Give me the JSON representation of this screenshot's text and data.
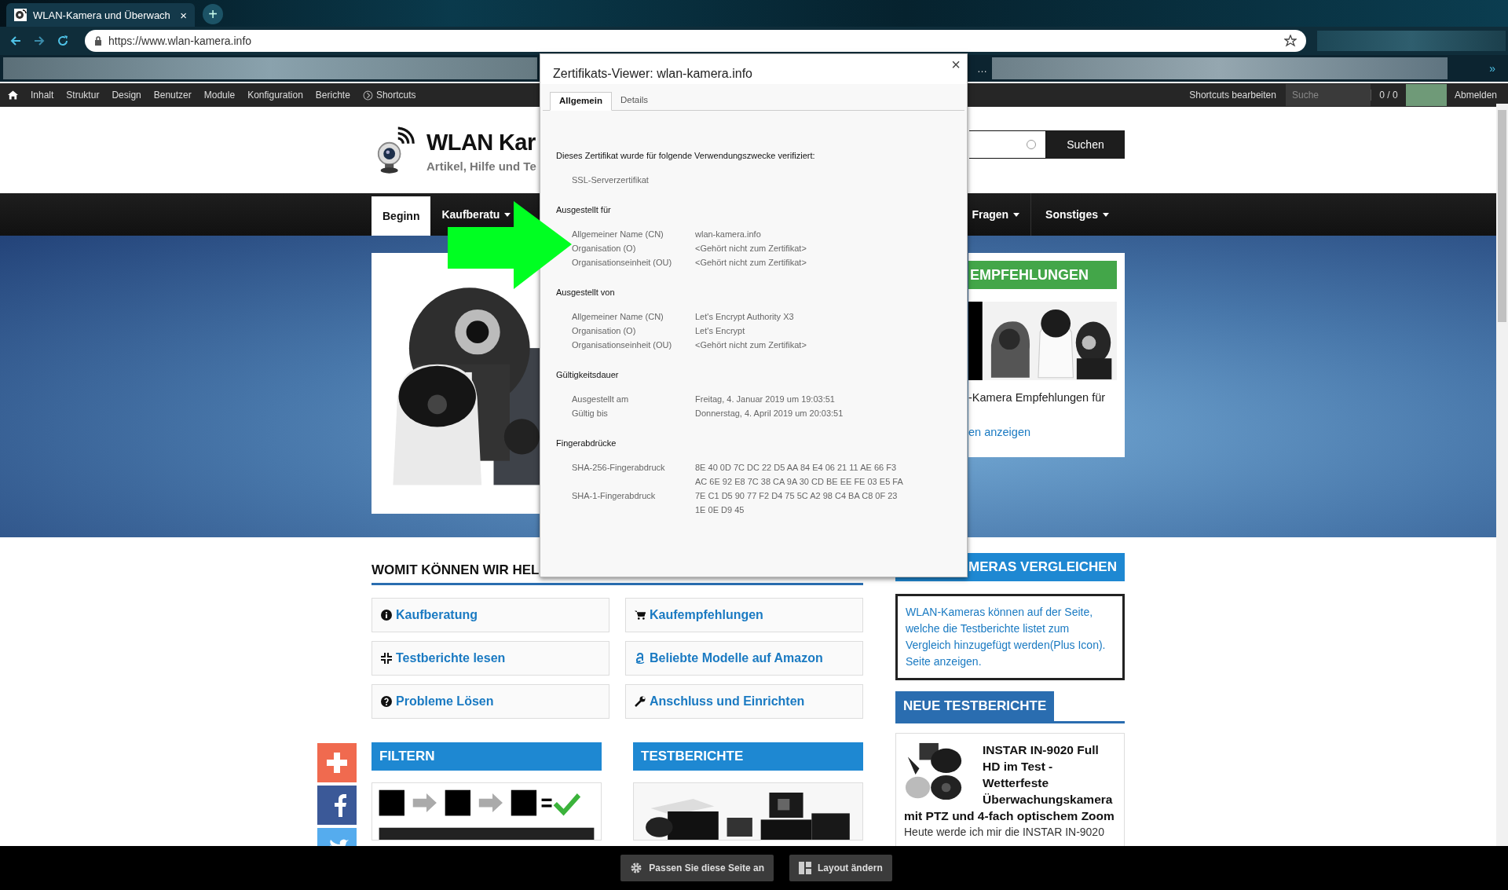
{
  "browser": {
    "tab": {
      "title": "WLAN-Kamera und Überwach",
      "close": "×",
      "selected": true
    },
    "new_tab": "+",
    "url": "https://www.wlan-kamera.info",
    "bookmark_ellipsis": "…",
    "bookmarks_overflow": "»"
  },
  "admin_toolbar": {
    "items": [
      {
        "label": "Inhalt",
        "kind": "text"
      },
      {
        "label": "Struktur",
        "kind": "text"
      },
      {
        "label": "Design",
        "kind": "text"
      },
      {
        "label": "Benutzer",
        "kind": "text"
      },
      {
        "label": "Module",
        "kind": "text"
      },
      {
        "label": "Konfiguration",
        "kind": "text"
      },
      {
        "label": "Berichte",
        "kind": "text"
      },
      {
        "label": "Shortcuts",
        "kind": "shortcuts"
      }
    ],
    "edit_shortcuts": "Shortcuts bearbeiten",
    "search_placeholder": "Suche",
    "counter": "0 / 0",
    "logout": "Abmelden"
  },
  "site_header": {
    "title": "WLAN Kar",
    "tagline": "Artikel, Hilfe und Te",
    "search_button": "Suchen"
  },
  "nav": [
    {
      "label": "Beginn",
      "selected": true,
      "dropdown": false
    },
    {
      "label": "Kaufberatu",
      "selected": false,
      "dropdown": true
    },
    {
      "label": "Fragen",
      "selected": false,
      "dropdown": true
    },
    {
      "label": "Sonstiges",
      "selected": false,
      "dropdown": true
    }
  ],
  "hero": {
    "recommendations": {
      "heading": "EMPFEHLUNGEN",
      "text": "-Kamera Empfehlungen für",
      "link": "en anzeigen"
    }
  },
  "help": {
    "heading": "WOMIT KÖNNEN WIR HEL",
    "links": [
      {
        "label": "Kaufberatung",
        "kind": "info"
      },
      {
        "label": "Kaufempfehlungen",
        "kind": "cart"
      },
      {
        "label": "Testberichte lesen",
        "kind": "compress"
      },
      {
        "label": "Beliebte Modelle auf Amazon",
        "kind": "amazon"
      },
      {
        "label": "Probleme Lösen",
        "kind": "question"
      },
      {
        "label": "Anschluss und Einrichten",
        "kind": "wrench"
      }
    ]
  },
  "blocks": [
    {
      "heading": "FILTERN",
      "kind": "filter"
    },
    {
      "heading": "TESTBERICHTE",
      "kind": "boxes"
    }
  ],
  "social": [
    {
      "kind": "plus"
    },
    {
      "kind": "facebook"
    },
    {
      "kind": "twitter"
    }
  ],
  "sidebar": {
    "compare": {
      "heading": "MERAS VERGLEICHEN",
      "text": "WLAN-Kameras können auf der Seite, welche die Testberichte listet zum Vergleich hinzugefügt werden(Plus Icon). Seite anzeigen."
    },
    "new_reviews": {
      "heading": "NEUE TESTBERICHTE",
      "title": "INSTAR IN-9020 Full HD im Test - Wetterfeste Überwachungskamera mit PTZ und 4-fach optischem Zoom",
      "excerpt": "Heute werde ich mir die INSTAR IN-9020"
    }
  },
  "bottom_bar": {
    "buttons": [
      {
        "label": "Passen Sie diese Seite an",
        "kind": "gear"
      },
      {
        "label": "Layout ändern",
        "kind": "layout"
      }
    ]
  },
  "dialog": {
    "title": "Zertifikats-Viewer: wlan-kamera.info",
    "close": "×",
    "tabs": [
      {
        "label": "Allgemein",
        "selected": true
      },
      {
        "label": "Details",
        "selected": false
      }
    ],
    "intro": "Dieses Zertifikat wurde für folgende Verwendungszwecke verifiziert:",
    "usages": [
      "SSL-Serverzertifikat"
    ],
    "sections": [
      {
        "heading": "Ausgestellt für",
        "rows": [
          {
            "label": "Allgemeiner Name (CN)",
            "lines": [
              "wlan-kamera.info"
            ]
          },
          {
            "label": "Organisation (O)",
            "lines": [
              "<Gehört nicht zum Zertifikat>"
            ]
          },
          {
            "label": "Organisationseinheit (OU)",
            "lines": [
              "<Gehört nicht zum Zertifikat>"
            ]
          }
        ]
      },
      {
        "heading": "Ausgestellt von",
        "rows": [
          {
            "label": "Allgemeiner Name (CN)",
            "lines": [
              "Let's Encrypt Authority X3"
            ]
          },
          {
            "label": "Organisation (O)",
            "lines": [
              "Let's Encrypt"
            ]
          },
          {
            "label": "Organisationseinheit (OU)",
            "lines": [
              "<Gehört nicht zum Zertifikat>"
            ]
          }
        ]
      },
      {
        "heading": "Gültigkeitsdauer",
        "rows": [
          {
            "label": "Ausgestellt am",
            "lines": [
              "Freitag, 4. Januar 2019 um 19:03:51"
            ]
          },
          {
            "label": "Gültig bis",
            "lines": [
              "Donnerstag, 4. April 2019 um 20:03:51"
            ]
          }
        ]
      },
      {
        "heading": "Fingerabdrücke",
        "rows": [
          {
            "label": "SHA-256-Fingerabdruck",
            "lines": [
              "8E 40 0D 7C DC 22 D5 AA 84 E4 06 21 11 AE 66 F3",
              "AC 6E 92 E8 7C 38 CA 9A 30 CD BE EE FE 03 E5 FA"
            ]
          },
          {
            "label": "SHA-1-Fingerabdruck",
            "lines": [
              "7E C1 D5 90 77 F2 D4 75 5C A2 98 C4 BA C8 0F 23",
              "1E 0E D9 45"
            ]
          }
        ]
      }
    ]
  }
}
